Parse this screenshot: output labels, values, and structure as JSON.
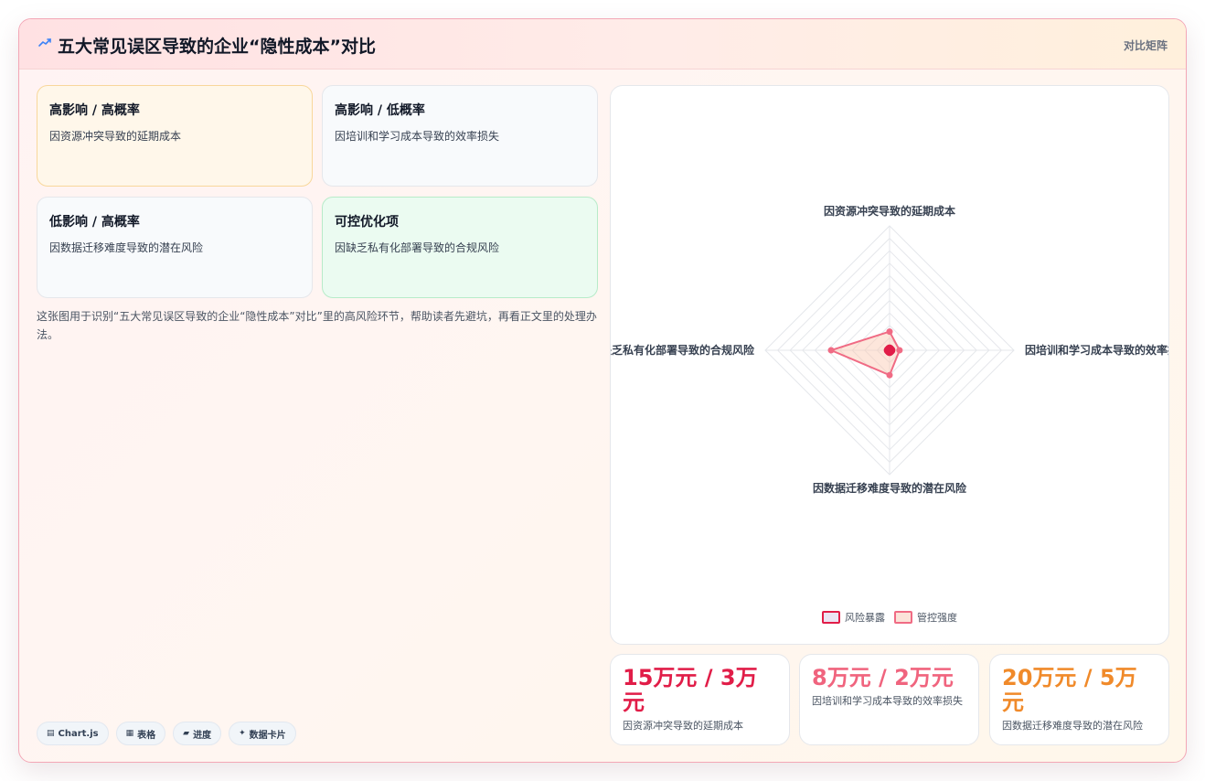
{
  "header": {
    "title": "五大常见误区导致的企业“隐性成本”对比",
    "right_label": "对比矩阵"
  },
  "cards": [
    {
      "title": "高影响 / 高概率",
      "desc": "因资源冲突导致的延期成本"
    },
    {
      "title": "高影响 / 低概率",
      "desc": "因培训和学习成本导致的效率损失"
    },
    {
      "title": "低影响 / 高概率",
      "desc": "因数据迁移难度导致的潜在风险"
    },
    {
      "title": "可控优化项",
      "desc": "因缺乏私有化部署导致的合规风险"
    }
  ],
  "note": "这张图用于识别“五大常见误区导致的企业“隐性成本”对比”里的高风险环节，帮助读者先避坑，再看正文里的处理办法。",
  "tags": [
    {
      "icon": "▤",
      "label": "Chart.js"
    },
    {
      "icon": "▦",
      "label": "表格"
    },
    {
      "icon": "▰",
      "label": "进度"
    },
    {
      "icon": "✦",
      "label": "数据卡片"
    }
  ],
  "stats": [
    {
      "value": "15万元 / 3万元",
      "label": "因资源冲突导致的延期成本",
      "color": "#e11d48"
    },
    {
      "value": "8万元 / 2万元",
      "label": "因培训和学习成本导致的效率损失",
      "color": "#f0647e"
    },
    {
      "value": "20万元 / 5万元",
      "label": "因数据迁移难度导致的潜在风险",
      "color": "#f08a2a"
    }
  ],
  "colors": {
    "risk": "#e11d48",
    "control": "#f06b84",
    "control_fill": "#fbe3d9"
  },
  "chart_data": {
    "type": "radar",
    "labels": [
      "因资源冲突导致的延期成本",
      "因培训和学习成本导致的效率损失",
      "因数据迁移难度导致的潜在风险",
      "因缺乏私有化部署导致的合规风险"
    ],
    "series": [
      {
        "name": "风险暴露",
        "values": [
          1,
          1,
          1,
          1
        ]
      },
      {
        "name": "管控强度",
        "values": [
          15,
          8,
          20,
          47
        ]
      }
    ],
    "rlim": [
      0,
      100
    ],
    "grid": true,
    "legend": "bottom"
  }
}
